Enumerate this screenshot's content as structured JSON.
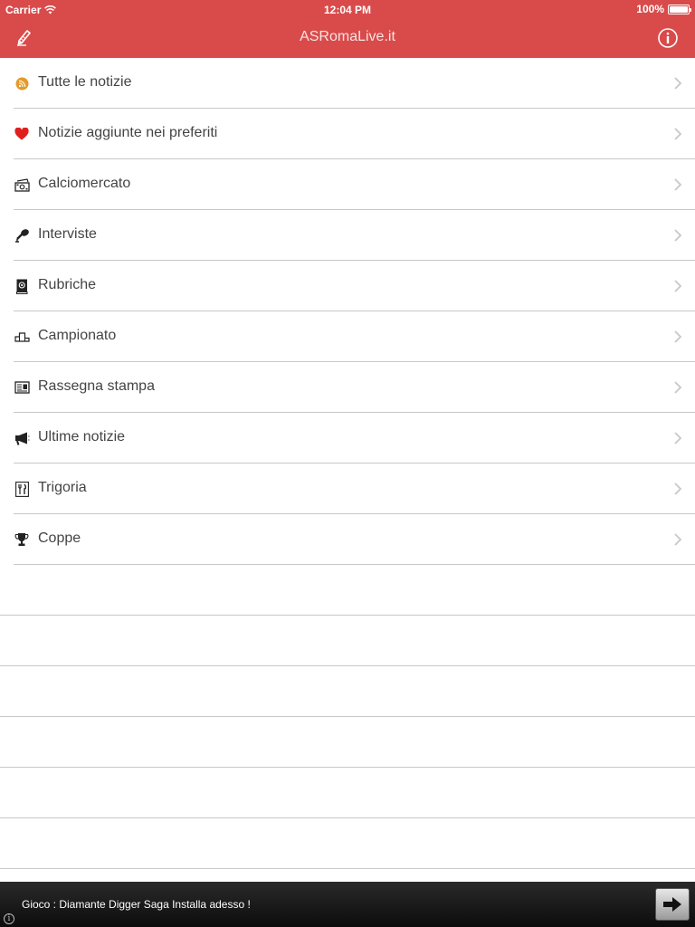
{
  "status_bar": {
    "carrier": "Carrier",
    "time": "12:04 PM",
    "battery": "100%"
  },
  "nav": {
    "title": "ASRomaLive.it",
    "left_icon": "compose-icon",
    "right_icon": "info-icon",
    "background": "#d94b4b"
  },
  "menu": [
    {
      "label": "Tutte le notizie",
      "icon": "rss-icon"
    },
    {
      "label": "Notizie aggiunte nei preferiti",
      "icon": "heart-icon"
    },
    {
      "label": "Calciomercato",
      "icon": "money-icon"
    },
    {
      "label": "Interviste",
      "icon": "microphone-icon"
    },
    {
      "label": "Rubriche",
      "icon": "address-book-icon"
    },
    {
      "label": "Campionato",
      "icon": "podium-icon"
    },
    {
      "label": "Rassegna stampa",
      "icon": "newspaper-icon"
    },
    {
      "label": "Ultime notizie",
      "icon": "megaphone-icon"
    },
    {
      "label": "Trigoria",
      "icon": "fork-knife-icon"
    },
    {
      "label": "Coppe",
      "icon": "trophy-icon"
    }
  ],
  "ad": {
    "text": "Gioco : Diamante Digger Saga Installa adesso !",
    "info_glyph": "i"
  }
}
